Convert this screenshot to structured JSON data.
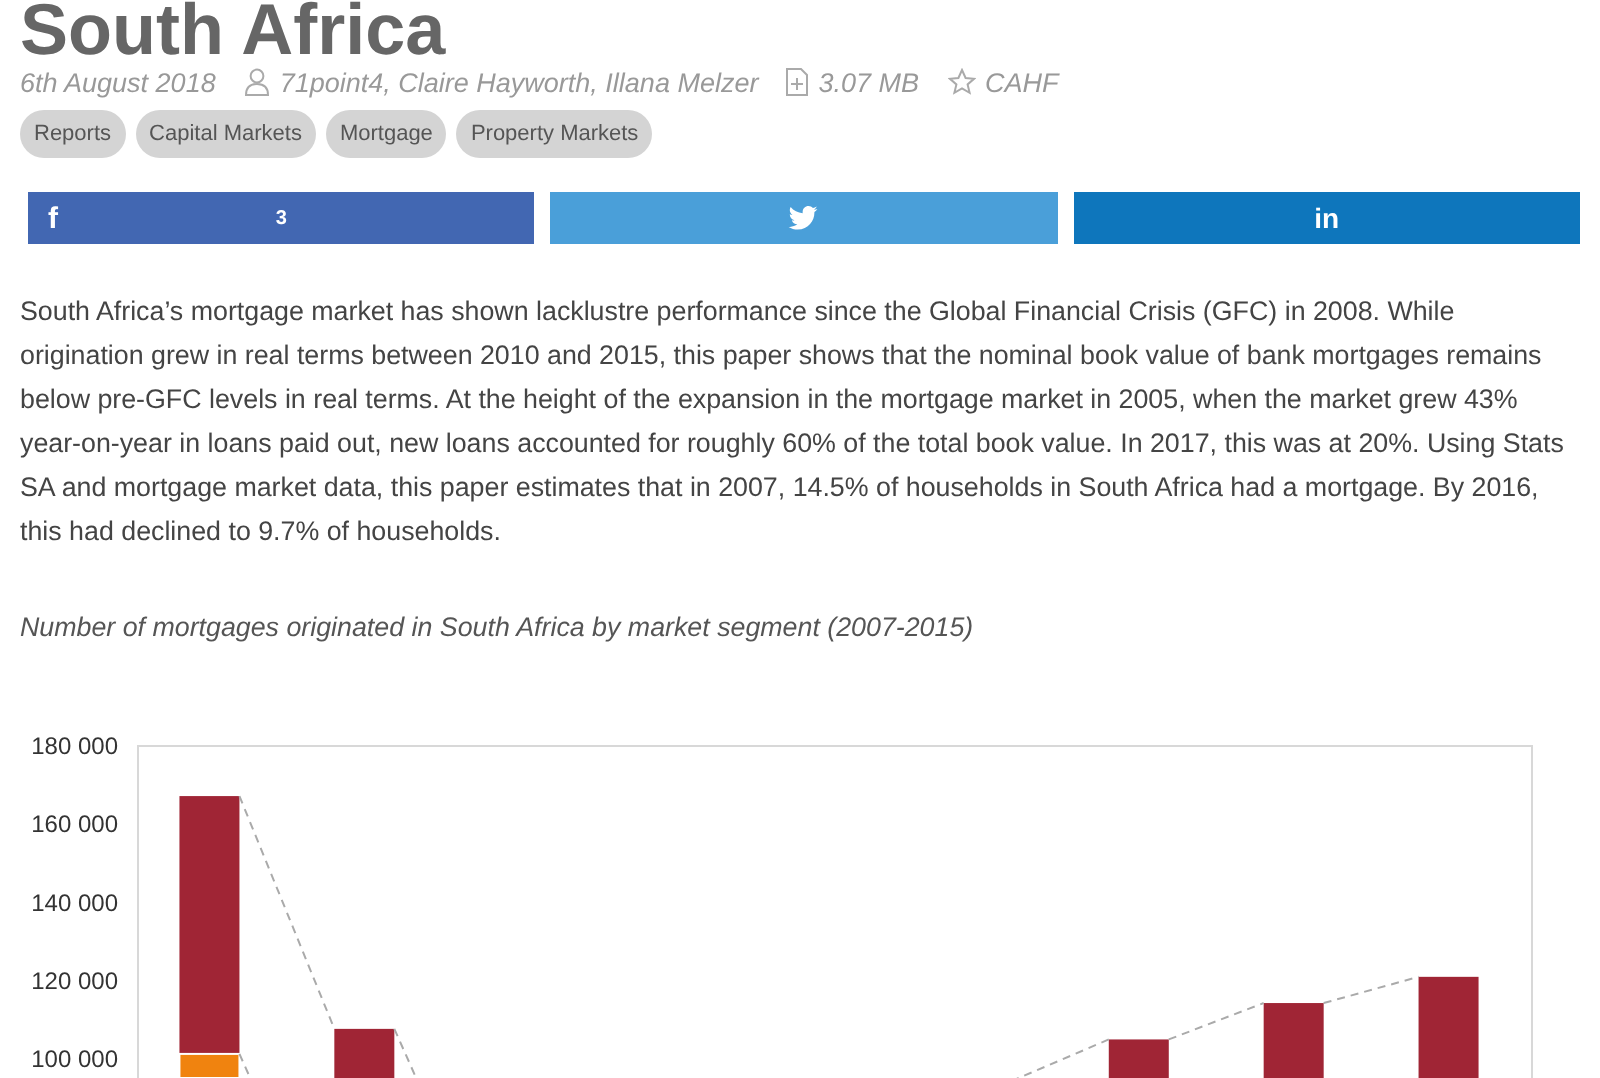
{
  "title": "South Africa",
  "meta": {
    "date": "6th August 2018",
    "authors": "71point4, Claire Hayworth, Illana Melzer",
    "file_size": "3.07 MB",
    "publisher": "CAHF"
  },
  "tags": [
    "Reports",
    "Capital Markets",
    "Mortgage",
    "Property Markets"
  ],
  "share_buttons": [
    {
      "kind": "facebook",
      "glyph": "f",
      "count": "3"
    },
    {
      "kind": "twitter"
    },
    {
      "kind": "linkedin",
      "glyph": "in"
    }
  ],
  "body": "South Africa’s mortgage market has shown lacklustre performance since the Global Financial Crisis (GFC) in 2008.  While origination grew in real terms between 2010 and 2015, this paper shows that the nominal book value of bank mortgages remains below pre-GFC levels in real terms. At the height of the expansion in the mortgage market in 2005, when the market grew 43% year-on-year in loans paid out, new loans accounted for roughly 60% of the total book value. In 2017, this was at 20%.  Using Stats SA and mortgage market data, this paper estimates that in 2007, 14.5% of households in South Africa had a mortgage.  By 2016, this had declined to 9.7% of households.",
  "chart_caption": "Number of mortgages originated in South Africa by market segment (2007-2015)",
  "chart": {
    "chart_data": {
      "type": "bar",
      "ylim": [
        95000,
        180000
      ],
      "series": [
        {
          "color": "#a02535",
          "values": [
            167200,
            107700,
            null,
            null,
            null,
            null,
            105000,
            114300,
            121000
          ]
        },
        {
          "color": "#f0830f",
          "values": [
            101300,
            null,
            null,
            null,
            null,
            null,
            null,
            null,
            null
          ]
        }
      ],
      "yticks": [
        {
          "value": 100000,
          "label": "100 000"
        },
        {
          "value": 120000,
          "label": "120 000"
        },
        {
          "value": 140000,
          "label": "140 000"
        },
        {
          "value": 160000,
          "label": "160 000"
        },
        {
          "value": 180000,
          "label": "180 000"
        }
      ]
    }
  }
}
